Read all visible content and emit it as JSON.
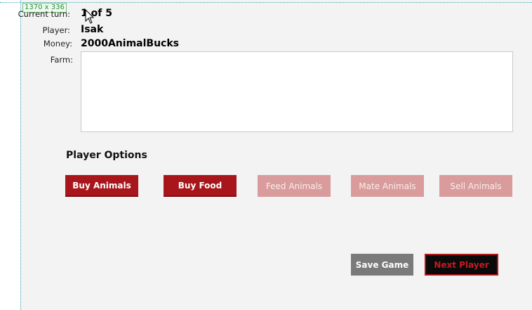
{
  "overlay": {
    "size_tag": "1370 x 336"
  },
  "info": {
    "current_turn_label": "Current turn:",
    "current_turn_value": "1 of 5",
    "player_label": "Player:",
    "player_value": "Isak",
    "money_label": "Money:",
    "money_value": "2000AnimalBucks",
    "farm_label": "Farm:",
    "farm_value": ""
  },
  "options": {
    "title": "Player Options",
    "buttons": [
      {
        "label": "Buy Animals",
        "enabled": true
      },
      {
        "label": "Buy Food",
        "enabled": true
      },
      {
        "label": "Feed Animals",
        "enabled": false
      },
      {
        "label": "Mate Animals",
        "enabled": false
      },
      {
        "label": "Sell Animals",
        "enabled": false
      }
    ]
  },
  "footer": {
    "save_label": "Save Game",
    "next_label": "Next Player"
  },
  "colors": {
    "accent": "#a8161b",
    "accent_disabled": "#d99b9b",
    "background": "#f3f3f3"
  }
}
